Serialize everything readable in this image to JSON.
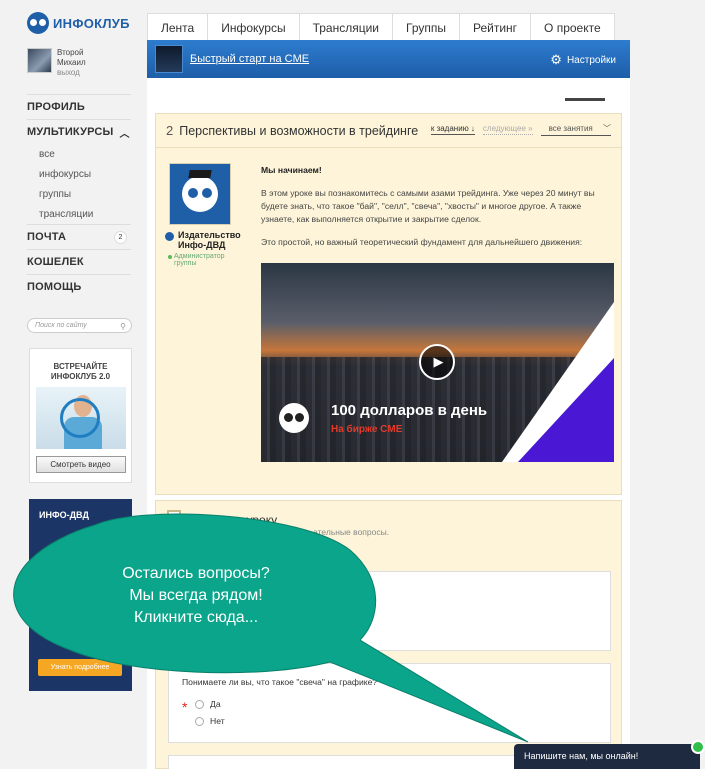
{
  "app": {
    "logo_text": "ИНФОКЛУБ"
  },
  "user": {
    "first_name": "Второй",
    "last_name": "Михаил",
    "logout": "выход"
  },
  "sidebar": {
    "profile": "ПРОФИЛЬ",
    "multicourses": "МУЛЬТИКУРСЫ",
    "sub": [
      "все",
      "инфокурсы",
      "группы",
      "трансляции"
    ],
    "mail": "ПОЧТА",
    "mail_badge": "2",
    "wallet": "КОШЕЛЕК",
    "help": "ПОМОЩЬ",
    "search_placeholder": "Поиск по сайту",
    "promo_title_1": "ВСТРЕЧАЙТЕ",
    "promo_title_2": "ИНФОКЛУБ 2.0",
    "promo_button": "Смотреть видео",
    "banner_logo": "ИНФО-ДВД",
    "banner_button": "Узнать подробнее"
  },
  "tabs": [
    "Лента",
    "Инфокурсы",
    "Трансляции",
    "Группы",
    "Рейтинг",
    "О проекте"
  ],
  "course": {
    "title": "Быстрый старт на CME",
    "settings": "Настройки"
  },
  "lesson": {
    "number": "2",
    "title": "Перспективы и возможности в трейдинге",
    "nav_prev": "к заданию ↓",
    "nav_next": "следующее »",
    "nav_all": "все занятия",
    "author_name_1": "Издательство",
    "author_name_2": "Инфо-ДВД",
    "author_role": "Администратор группы",
    "lead": "Мы начинаем!",
    "p1": "В этом уроке вы познакомитесь с самыми азами трейдинга. Уже через 20 минут вы будете знать, что такое \"бай\", \"селл\", \"свеча\", \"хвосты\" и многое другое. А также узнаете, как выполняется открытие и закрытие сделок.",
    "p2": "Это простой, но важный теоретический фундамент для дальнейшего движения:",
    "video_title": "100 долларов в день",
    "video_subtitle": "На бирже CME"
  },
  "task": {
    "title": "Задание к уроку",
    "hint": "...ательные вопросы.",
    "q2_label": "Понимаете ли вы, что такое \"свеча\" на графике?",
    "required_mark": "*",
    "options": [
      "Да",
      "Нет"
    ]
  },
  "bubble": {
    "line1": "Остались вопросы?",
    "line2": "Мы всегда рядом!",
    "line3": "Кликните сюда..."
  },
  "chat": {
    "label": "Напишите нам, мы онлайн!"
  },
  "colors": {
    "accent": "#1f5fa8",
    "bubble": "#0aa58a",
    "video_accent": "#4a17d4"
  }
}
